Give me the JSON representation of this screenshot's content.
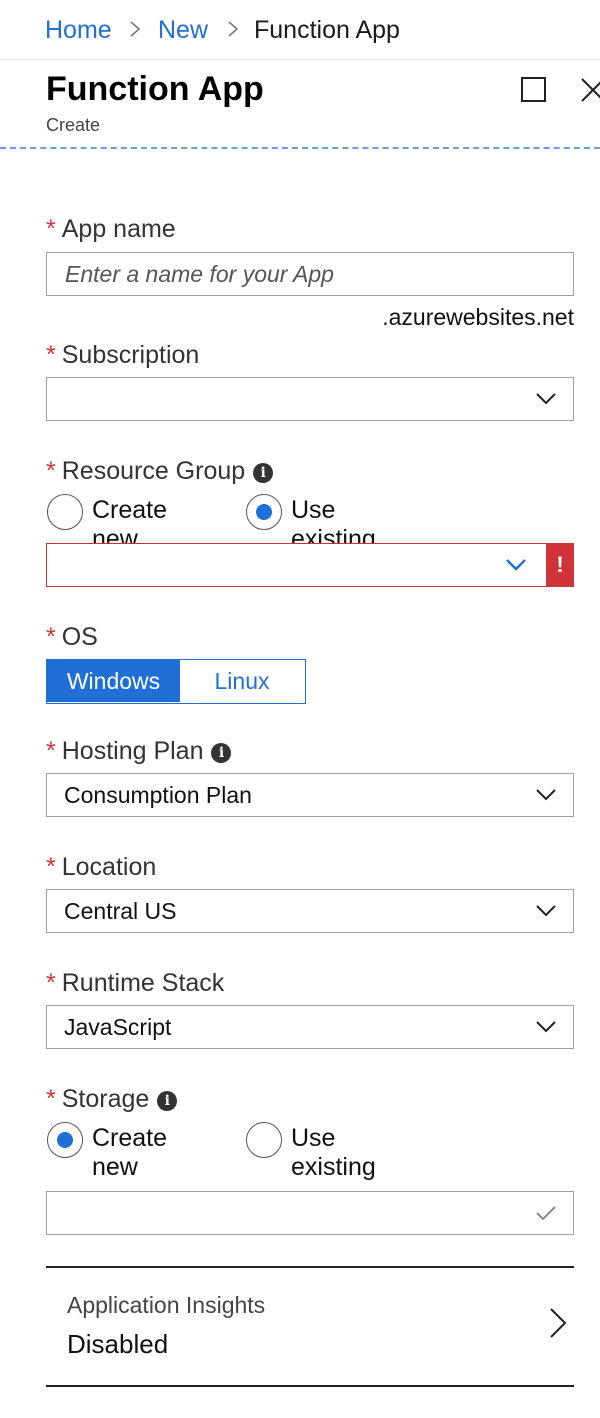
{
  "breadcrumb": {
    "items": [
      "Home",
      "New"
    ],
    "current": "Function App"
  },
  "blade": {
    "title": "Function App",
    "subtitle": "Create"
  },
  "form": {
    "app_name": {
      "label": "App name",
      "placeholder": "Enter a name for your App",
      "suffix": ".azurewebsites.net"
    },
    "subscription": {
      "label": "Subscription",
      "value": ""
    },
    "resource_group": {
      "label": "Resource Group",
      "options": [
        "Create new",
        "Use existing"
      ],
      "selected": "Use existing",
      "value": "",
      "error_mark": "!"
    },
    "os": {
      "label": "OS",
      "options": [
        "Windows",
        "Linux"
      ],
      "selected": "Windows"
    },
    "hosting_plan": {
      "label": "Hosting Plan",
      "value": "Consumption Plan"
    },
    "location": {
      "label": "Location",
      "value": "Central US"
    },
    "runtime_stack": {
      "label": "Runtime Stack",
      "value": "JavaScript"
    },
    "storage": {
      "label": "Storage",
      "options": [
        "Create new",
        "Use existing"
      ],
      "selected": "Create new",
      "value": ""
    },
    "app_insights": {
      "label": "Application Insights",
      "value": "Disabled"
    }
  },
  "icons": {
    "breadcrumb_separator": "chevron-right-icon",
    "maximize": "maximize-icon",
    "close": "close-icon",
    "info": "info-icon",
    "dropdown": "chevron-down-icon",
    "valid": "checkmark-icon",
    "error": "error-icon",
    "navigate": "chevron-right-icon"
  },
  "colors": {
    "accent": "#1f6fd6",
    "required": "#d13438",
    "error": "#d13438"
  }
}
